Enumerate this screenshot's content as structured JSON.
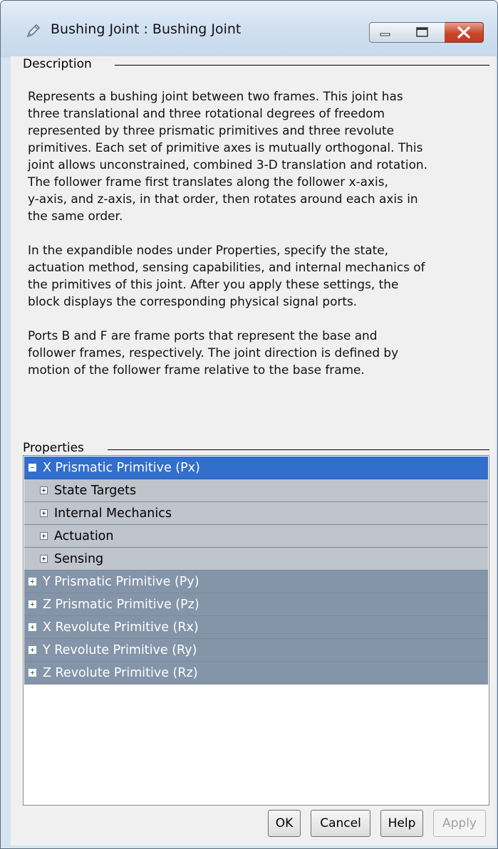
{
  "window": {
    "title": "Bushing Joint : Bushing Joint",
    "controls": [
      "minimize-icon",
      "maximize-icon",
      "close-icon"
    ],
    "accent": "#326ecc"
  },
  "description": {
    "legend": "Description",
    "paragraphs": [
      "Represents a bushing joint between two frames. This joint has\nthree translational and three rotational degrees of freedom\nrepresented by three prismatic primitives and three revolute\nprimitives. Each set of primitive axes is mutually orthogonal. This\njoint allows unconstrained, combined 3-D translation and rotation.\nThe follower frame first translates along the follower x-axis,\ny-axis, and z-axis, in that order, then rotates around each axis in\nthe same order.",
      "In the expandible nodes under Properties, specify the state,\nactuation method, sensing capabilities, and internal mechanics of\nthe primitives of this joint. After you apply these settings, the\nblock displays the corresponding physical signal ports.",
      "Ports B and F are frame ports that represent the base and\nfollower frames, respectively. The joint direction is defined by\nmotion of the follower frame relative to the base frame."
    ]
  },
  "properties": {
    "legend": "Properties",
    "tree": [
      {
        "label": "X Prismatic Primitive (Px)",
        "level": 0,
        "expanded": true,
        "selected": true
      },
      {
        "label": "State Targets",
        "level": 1,
        "expanded": false
      },
      {
        "label": "Internal Mechanics",
        "level": 1,
        "expanded": false
      },
      {
        "label": "Actuation",
        "level": 1,
        "expanded": false
      },
      {
        "label": "Sensing",
        "level": 1,
        "expanded": false
      },
      {
        "label": "Y Prismatic Primitive (Py)",
        "level": 0,
        "expanded": false
      },
      {
        "label": "Z Prismatic Primitive (Pz)",
        "level": 0,
        "expanded": false
      },
      {
        "label": "X Revolute Primitive (Rx)",
        "level": 0,
        "expanded": false
      },
      {
        "label": "Y Revolute Primitive (Ry)",
        "level": 0,
        "expanded": false
      },
      {
        "label": "Z Revolute Primitive (Rz)",
        "level": 0,
        "expanded": false
      }
    ]
  },
  "buttons": {
    "ok": "OK",
    "cancel": "Cancel",
    "help": "Help",
    "apply": "Apply"
  }
}
